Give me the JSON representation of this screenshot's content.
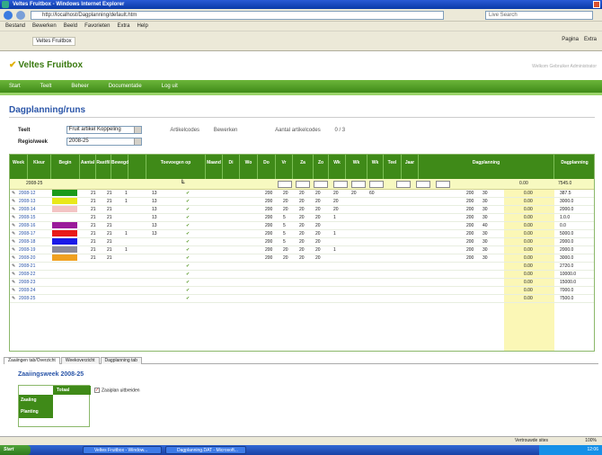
{
  "window": {
    "title": "Veltes Fruitbox - Windows Internet Explorer"
  },
  "browser": {
    "address": "http://localhost/Dagplanning/default.htm",
    "search_placeholder": "Live Search",
    "menu": [
      "Bestand",
      "Bewerken",
      "Beeld",
      "Favorieten",
      "Extra",
      "Help"
    ],
    "favorite_tab": "Veltes Fruitbox",
    "tools": [
      "Pagina",
      "Extra"
    ]
  },
  "site": {
    "brand": "Veltes Fruitbox",
    "user_info": "Welkom Gebruiker Administrator",
    "nav": [
      "Start",
      "Teelt",
      "Beheer",
      "Documentatie",
      "Log uit"
    ]
  },
  "page": {
    "title": "Dagplanning/runs"
  },
  "filters": {
    "teelt_label": "Teelt",
    "teelt_value": "Fruit artikel Koppeling",
    "teelt_extra_label": "Artikelcodes",
    "teelt_extra_value": "Bewerken",
    "regio_extra_label": "Aantal artikelcodes",
    "regio_extra_value": "0 / 3",
    "regio_label": "Regio/week",
    "regio_value": "2008-25"
  },
  "grid": {
    "columns": [
      "Week",
      "Kleur",
      "Begin",
      "Aantal",
      "Rastfil",
      "Bewegd",
      "",
      "Toevoegen op",
      "Maand",
      "Di",
      "Wo",
      "Do",
      "Vr",
      "Za",
      "Zo",
      "Wk",
      "Wk",
      "Wk",
      "Teel",
      "Jaar",
      "Dagplanning",
      "Dagplanning"
    ],
    "rows": [
      {
        "week": "2008-12",
        "color": "#1a9a1a",
        "a": "21",
        "b": "21",
        "c": "1",
        "d": "13",
        "e": "200",
        "f": "20",
        "g": "20",
        "h": "20",
        "i": "20",
        "j": "20",
        "k": "60",
        "l": "200",
        "m": "30",
        "n": "0.00",
        "o": "387.5"
      },
      {
        "week": "2008-13",
        "color": "#e8e81a",
        "a": "21",
        "b": "21",
        "c": "1",
        "d": "13",
        "e": "200",
        "f": "20",
        "g": "20",
        "h": "20",
        "i": "20",
        "j": "",
        "k": "",
        "l": "200",
        "m": "30",
        "n": "0.00",
        "o": "3000.0"
      },
      {
        "week": "2008-14",
        "color": "#f3c4c4",
        "a": "21",
        "b": "21",
        "c": "",
        "d": "13",
        "e": "200",
        "f": "20",
        "g": "20",
        "h": "20",
        "i": "20",
        "j": "",
        "k": "",
        "l": "200",
        "m": "30",
        "n": "0.00",
        "o": "2000.0"
      },
      {
        "week": "2008-15",
        "color": "",
        "a": "21",
        "b": "21",
        "c": "",
        "d": "13",
        "e": "200",
        "f": "5",
        "g": "20",
        "h": "20",
        "i": "1",
        "j": "",
        "k": "",
        "l": "200",
        "m": "30",
        "n": "0.00",
        "o": "1.0.0"
      },
      {
        "week": "2008-16",
        "color": "#9a1a9a",
        "a": "21",
        "b": "21",
        "c": "",
        "d": "13",
        "e": "200",
        "f": "5",
        "g": "20",
        "h": "20",
        "i": "",
        "j": "",
        "k": "",
        "l": "200",
        "m": "40",
        "n": "0.00",
        "o": "0.0"
      },
      {
        "week": "2008-17",
        "color": "#e81a1a",
        "a": "21",
        "b": "21",
        "c": "1",
        "d": "13",
        "e": "200",
        "f": "5",
        "g": "20",
        "h": "20",
        "i": "1",
        "j": "",
        "k": "",
        "l": "200",
        "m": "30",
        "n": "0.00",
        "o": "5000.0"
      },
      {
        "week": "2008-18",
        "color": "#1a1ae8",
        "a": "21",
        "b": "21",
        "c": "",
        "d": "",
        "e": "200",
        "f": "5",
        "g": "20",
        "h": "20",
        "i": "",
        "j": "",
        "k": "",
        "l": "200",
        "m": "30",
        "n": "0.00",
        "o": "2000.0"
      },
      {
        "week": "2008-19",
        "color": "#8a8a9a",
        "a": "21",
        "b": "21",
        "c": "1",
        "d": "",
        "e": "200",
        "f": "20",
        "g": "20",
        "h": "20",
        "i": "1",
        "j": "",
        "k": "",
        "l": "200",
        "m": "30",
        "n": "0.00",
        "o": "2000.0"
      },
      {
        "week": "2008-20",
        "color": "#f0a020",
        "a": "21",
        "b": "21",
        "c": "",
        "d": "",
        "e": "200",
        "f": "20",
        "g": "20",
        "h": "20",
        "i": "",
        "j": "",
        "k": "",
        "l": "200",
        "m": "30",
        "n": "0.00",
        "o": "3000.0"
      },
      {
        "week": "2008-21",
        "color": "",
        "a": "",
        "b": "",
        "c": "",
        "d": "",
        "e": "",
        "f": "",
        "g": "",
        "h": "",
        "i": "",
        "j": "",
        "k": "",
        "l": "",
        "m": "",
        "n": "0.00",
        "o": "2720.0"
      },
      {
        "week": "2008-22",
        "color": "",
        "a": "",
        "b": "",
        "c": "",
        "d": "",
        "e": "",
        "f": "",
        "g": "",
        "h": "",
        "i": "",
        "j": "",
        "k": "",
        "l": "",
        "m": "",
        "n": "0.00",
        "o": "10000.0"
      },
      {
        "week": "2008-23",
        "color": "",
        "a": "",
        "b": "",
        "c": "",
        "d": "",
        "e": "",
        "f": "",
        "g": "",
        "h": "",
        "i": "",
        "j": "",
        "k": "",
        "l": "",
        "m": "",
        "n": "0.00",
        "o": "15000.0"
      },
      {
        "week": "2008-24",
        "color": "",
        "a": "",
        "b": "",
        "c": "",
        "d": "",
        "e": "",
        "f": "",
        "g": "",
        "h": "",
        "i": "",
        "j": "",
        "k": "",
        "l": "",
        "m": "",
        "n": "0.00",
        "o": "7000.0"
      },
      {
        "week": "2008-25",
        "color": "",
        "a": "",
        "b": "",
        "c": "",
        "d": "",
        "e": "",
        "f": "",
        "g": "",
        "h": "",
        "i": "",
        "j": "",
        "k": "",
        "l": "",
        "m": "",
        "n": "0.00",
        "o": "7500.0"
      }
    ],
    "filter_row": {
      "week": "2008-25",
      "total_a": "0.00",
      "total_b": "7545.0"
    }
  },
  "tabs": [
    "Zaaiingen tab/Overzicht",
    "Weekoverzicht",
    "Dagplanning tab"
  ],
  "zaai": {
    "title": "Zaaiingsweek 2008-25",
    "col": "Totaal",
    "rows": [
      "Zaaiing",
      "Planting"
    ],
    "checkbox_label": "Zaaiplan uitbreiden"
  },
  "status": {
    "zone": "Vertrouwde sites",
    "zoom": "100%"
  },
  "taskbar": {
    "start": "Start",
    "items": [
      "Veltes Fruitbox - Window...",
      "Dagplanning.DAT - Microsoft..."
    ],
    "clock": "12:06"
  },
  "colors": {
    "green_dark": "#3f8a18",
    "green_light": "#6cb63a",
    "title_blue": "#2a55a8",
    "highlight": "#fbf7b6"
  }
}
